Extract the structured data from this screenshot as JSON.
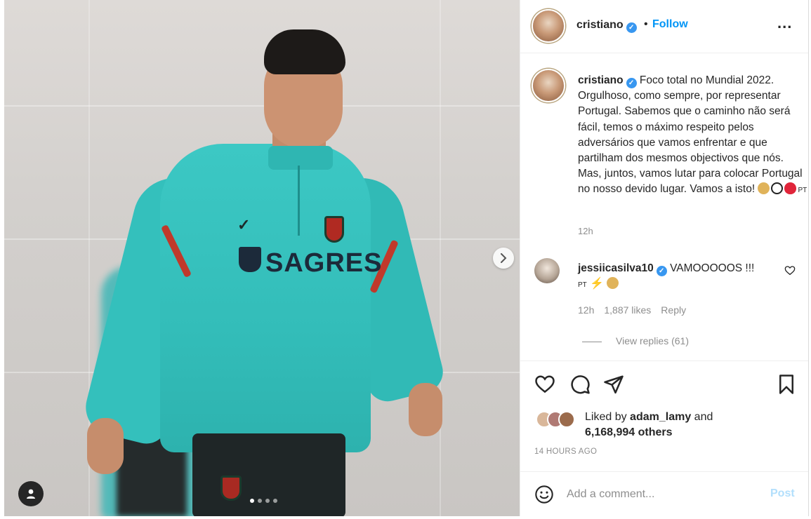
{
  "post": {
    "author": "cristiano",
    "follow_label": "Follow",
    "more_label": "...",
    "caption": "Foco total no Mundial 2022. Orgulhoso, como sempre, por representar Portugal. Sabemos que o caminho não será fácil, temos o máximo respeito pelos adversários que vamos enfrentar e que partilham dos mesmos objectivos que nós. Mas, juntos, vamos lutar para colocar Portugal no nosso devido lugar. Vamos a isto!",
    "caption_tag": "PT",
    "caption_time": "12h",
    "photo": {
      "sponsor_text": "SAGRES",
      "carousel_count": 4,
      "active_slide": 1
    }
  },
  "comment": {
    "username": "jessiicasilva10",
    "text": "VAMOOOOOS !!!",
    "tag": "PT",
    "time": "12h",
    "likes": "1,887 likes",
    "reply_label": "Reply",
    "view_replies": "View replies (61)"
  },
  "likes": {
    "prefix": "Liked by",
    "user": "adam_lamy",
    "middle": "and",
    "others": "6,168,994 others"
  },
  "date": "14 HOURS AGO",
  "add_comment": {
    "placeholder": "Add a comment...",
    "post_label": "Post"
  },
  "colors": {
    "link_blue": "#0095f6",
    "verified_blue": "#3897f0",
    "muted_text": "#8e8e8e",
    "post_disabled": "#b2dffc",
    "jersey_teal": "#3cc8c4"
  },
  "icons": [
    "chevron-right-icon",
    "user-tag-icon",
    "verified-badge-icon",
    "more-icon",
    "heart-icon",
    "comment-icon",
    "share-icon",
    "bookmark-icon",
    "smile-icon"
  ]
}
